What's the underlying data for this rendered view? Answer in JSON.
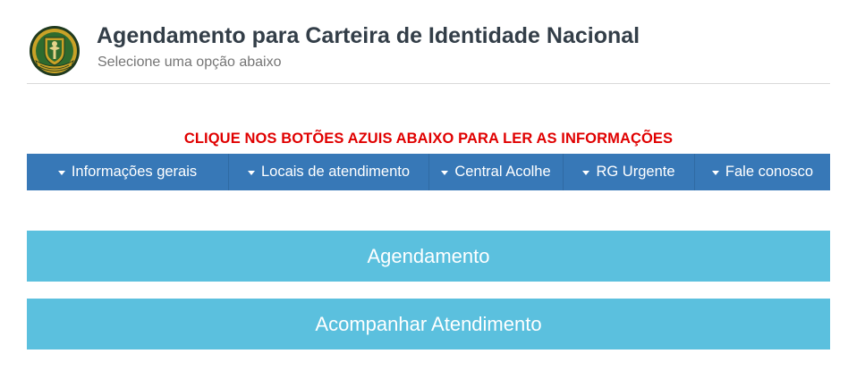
{
  "header": {
    "title": "Agendamento para Carteira de Identidade Nacional",
    "subtitle": "Selecione uma opção abaixo",
    "logo_icon": "police-emblem-icon"
  },
  "notice": "CLIQUE NOS BOTÕES AZUIS ABAIXO PARA LER AS INFORMAÇÕES",
  "nav": {
    "items": [
      {
        "label": "Informações gerais"
      },
      {
        "label": "Locais de atendimento"
      },
      {
        "label": "Central Acolhe"
      },
      {
        "label": "RG Urgente"
      },
      {
        "label": "Fale conosco"
      }
    ]
  },
  "buttons": {
    "agendamento": "Agendamento",
    "acompanhar": "Acompanhar Atendimento"
  },
  "colors": {
    "nav_bg": "#3778b7",
    "button_bg": "#5bc0de",
    "notice": "#e00000",
    "title": "#333e48"
  }
}
